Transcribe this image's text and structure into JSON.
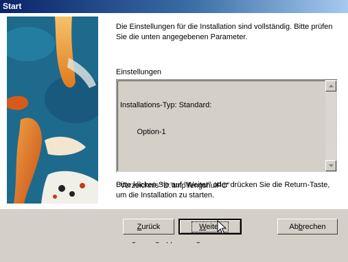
{
  "window": {
    "title": "Start"
  },
  "intro_text": "Die Einstellungen für die Installation sind vollständig. Bitte prüfen Sie die unten angegebenen Parameter.",
  "settings": {
    "label": "Einstellungen",
    "lines": [
      "Installations-Typ: Standard:",
      "        Option-1",
      "",
      "Verzeichnis \"D:\\tmp\\fengshuiPC\"",
      "",
      "Programmgruppe: \"fengshuiPC\""
    ]
  },
  "footer_text": "Bitte klicken Sie auf \"Weiter\" oder drücken Sie die Return-Taste, um die Installation zu starten.",
  "buttons": {
    "back": {
      "pre": "",
      "ul": "Z",
      "post": "urück"
    },
    "next": {
      "pre": "",
      "ul": "W",
      "post": "eiter"
    },
    "cancel": {
      "pre": "Ab",
      "ul": "b",
      "post": "rechen"
    }
  },
  "image": {
    "icon": "koi-fish-image"
  }
}
